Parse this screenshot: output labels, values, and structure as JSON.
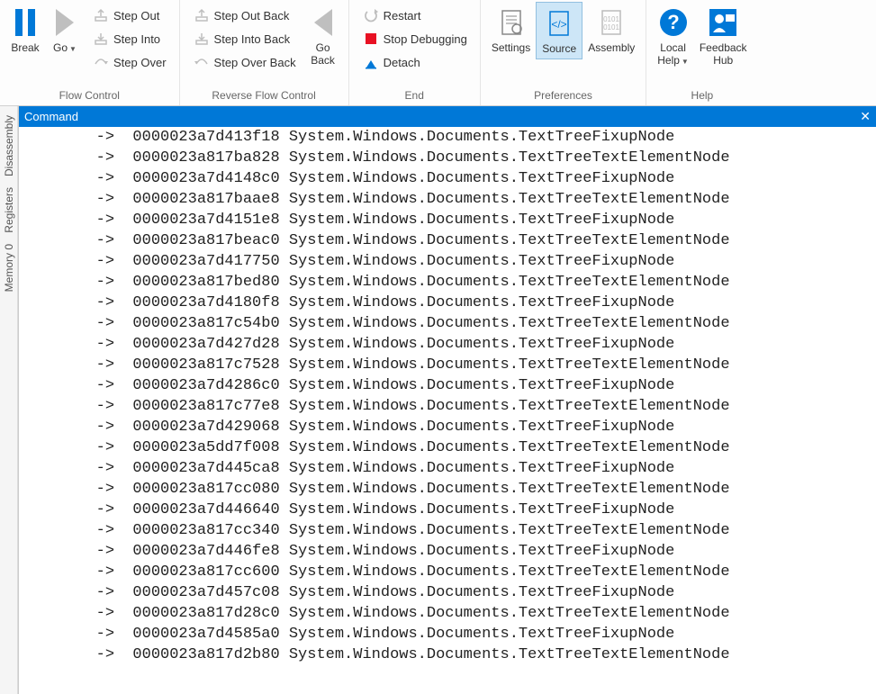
{
  "ribbon": {
    "flow": {
      "label": "Flow Control",
      "break": "Break",
      "go": "Go",
      "step_out": "Step Out",
      "step_into": "Step Into",
      "step_over": "Step Over"
    },
    "reverse": {
      "label": "Reverse Flow Control",
      "step_out_back": "Step Out Back",
      "step_into_back": "Step Into Back",
      "step_over_back": "Step Over Back",
      "go_back": "Go\nBack"
    },
    "end": {
      "label": "End",
      "restart": "Restart",
      "stop": "Stop Debugging",
      "detach": "Detach"
    },
    "prefs": {
      "label": "Preferences",
      "settings": "Settings",
      "source": "Source",
      "assembly": "Assembly"
    },
    "help": {
      "label": "Help",
      "local_help": "Local\nHelp",
      "feedback": "Feedback\nHub"
    }
  },
  "sidetabs": {
    "disassembly": "Disassembly",
    "registers": "Registers",
    "memory0": "Memory 0"
  },
  "panel": {
    "title": "Command",
    "close": "✕"
  },
  "output_lines": [
    "        ->  0000023a7d413f18 System.Windows.Documents.TextTreeFixupNode",
    "        ->  0000023a817ba828 System.Windows.Documents.TextTreeTextElementNode",
    "        ->  0000023a7d4148c0 System.Windows.Documents.TextTreeFixupNode",
    "        ->  0000023a817baae8 System.Windows.Documents.TextTreeTextElementNode",
    "        ->  0000023a7d4151e8 System.Windows.Documents.TextTreeFixupNode",
    "        ->  0000023a817beac0 System.Windows.Documents.TextTreeTextElementNode",
    "        ->  0000023a7d417750 System.Windows.Documents.TextTreeFixupNode",
    "        ->  0000023a817bed80 System.Windows.Documents.TextTreeTextElementNode",
    "        ->  0000023a7d4180f8 System.Windows.Documents.TextTreeFixupNode",
    "        ->  0000023a817c54b0 System.Windows.Documents.TextTreeTextElementNode",
    "        ->  0000023a7d427d28 System.Windows.Documents.TextTreeFixupNode",
    "        ->  0000023a817c7528 System.Windows.Documents.TextTreeTextElementNode",
    "        ->  0000023a7d4286c0 System.Windows.Documents.TextTreeFixupNode",
    "        ->  0000023a817c77e8 System.Windows.Documents.TextTreeTextElementNode",
    "        ->  0000023a7d429068 System.Windows.Documents.TextTreeFixupNode",
    "        ->  0000023a5dd7f008 System.Windows.Documents.TextTreeTextElementNode",
    "        ->  0000023a7d445ca8 System.Windows.Documents.TextTreeFixupNode",
    "        ->  0000023a817cc080 System.Windows.Documents.TextTreeTextElementNode",
    "        ->  0000023a7d446640 System.Windows.Documents.TextTreeFixupNode",
    "        ->  0000023a817cc340 System.Windows.Documents.TextTreeTextElementNode",
    "        ->  0000023a7d446fe8 System.Windows.Documents.TextTreeFixupNode",
    "        ->  0000023a817cc600 System.Windows.Documents.TextTreeTextElementNode",
    "        ->  0000023a7d457c08 System.Windows.Documents.TextTreeFixupNode",
    "        ->  0000023a817d28c0 System.Windows.Documents.TextTreeTextElementNode",
    "        ->  0000023a7d4585a0 System.Windows.Documents.TextTreeFixupNode",
    "        ->  0000023a817d2b80 System.Windows.Documents.TextTreeTextElementNode"
  ]
}
